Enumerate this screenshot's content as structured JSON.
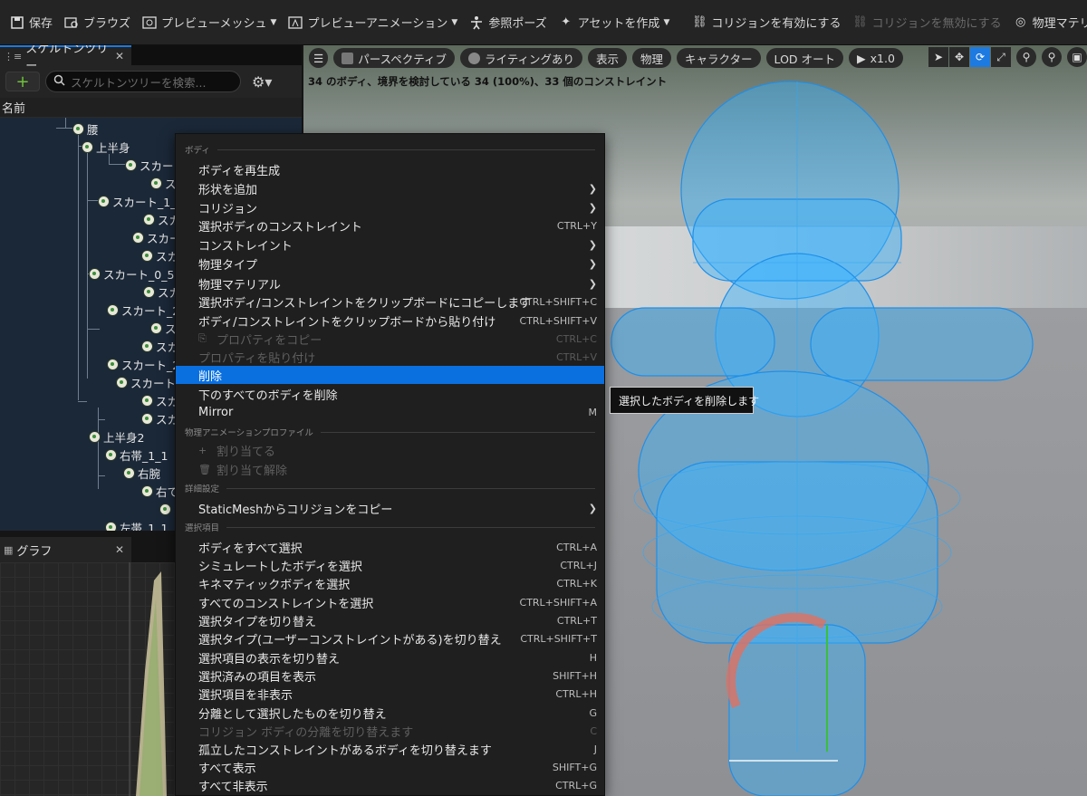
{
  "toolbar": {
    "save": "保存",
    "browse": "ブラウズ",
    "preview_mesh": "プレビューメッシュ",
    "preview_anim": "プレビューアニメーション",
    "ref_pose": "参照ポーズ",
    "create_asset": "アセットを作成",
    "enable_collision": "コリジョンを有効にする",
    "disable_collision": "コリジョンを無効にする",
    "physics_material": "物理マテリア"
  },
  "tree_panel": {
    "tab": "スケルトンツリー",
    "search_placeholder": "スケルトンツリーを検索...",
    "column_name": "名前",
    "rows": [
      "腰",
      "上半身",
      "スカー",
      "ス",
      "スカート_1_",
      "スカ",
      "スカー",
      "スカ",
      "スカート_0_5",
      "スカ",
      "スカート_2",
      "ス",
      "スカ",
      "スカート_2",
      "スカート",
      "スカ",
      "スカ",
      "上半身2",
      "右帯_1_1",
      "右腕",
      "右て",
      "",
      "左帯_1_1",
      "左腕",
      "左て",
      ""
    ]
  },
  "graph_panel": {
    "tab": "グラフ"
  },
  "viewport": {
    "perspective": "パースペクティブ",
    "lighting": "ライティングあり",
    "show": "表示",
    "physics": "物理",
    "character": "キャラクター",
    "lod": "LOD オート",
    "speed": "x1.0",
    "stats": "34 のボディ、境界を検討している 34 (100%)、33 個のコンストレイント"
  },
  "menu": {
    "sections": [
      "ボディ",
      "物理アニメーションプロファイル",
      "詳細設定",
      "選択項目"
    ],
    "items": [
      {
        "label": "ボディを再生成",
        "shortcut": ""
      },
      {
        "label": "形状を追加",
        "shortcut": ""
      },
      {
        "label": "コリジョン",
        "shortcut": ""
      },
      {
        "label": "選択ボディのコンストレイント",
        "shortcut": "CTRL+Y"
      },
      {
        "label": "コンストレイント",
        "shortcut": ""
      },
      {
        "label": "物理タイプ",
        "shortcut": ""
      },
      {
        "label": "物理マテリアル",
        "shortcut": ""
      },
      {
        "label": "選択ボディ/コンストレイントをクリップボードにコピーします",
        "shortcut": "CTRL+SHIFT+C"
      },
      {
        "label": "ボディ/コンストレイントをクリップボードから貼り付け",
        "shortcut": "CTRL+SHIFT+V"
      },
      {
        "label": "プロパティをコピー",
        "shortcut": "CTRL+C"
      },
      {
        "label": "プロパティを貼り付け",
        "shortcut": "CTRL+V"
      },
      {
        "label": "削除",
        "shortcut": ""
      },
      {
        "label": "下のすべてのボディを削除",
        "shortcut": ""
      },
      {
        "label": "Mirror",
        "shortcut": "M"
      },
      {
        "label": "割り当てる",
        "shortcut": ""
      },
      {
        "label": "割り当て解除",
        "shortcut": ""
      },
      {
        "label": "StaticMeshからコリジョンをコピー",
        "shortcut": ""
      },
      {
        "label": "ボディをすべて選択",
        "shortcut": "CTRL+A"
      },
      {
        "label": "シミュレートしたボディを選択",
        "shortcut": "CTRL+J"
      },
      {
        "label": "キネマティックボディを選択",
        "shortcut": "CTRL+K"
      },
      {
        "label": "すべてのコンストレイントを選択",
        "shortcut": "CTRL+SHIFT+A"
      },
      {
        "label": "選択タイプを切り替え",
        "shortcut": "CTRL+T"
      },
      {
        "label": "選択タイプ(ユーザーコンストレイントがある)を切り替え",
        "shortcut": "CTRL+SHIFT+T"
      },
      {
        "label": "選択項目の表示を切り替え",
        "shortcut": "H"
      },
      {
        "label": "選択済みの項目を表示",
        "shortcut": "SHIFT+H"
      },
      {
        "label": "選択項目を非表示",
        "shortcut": "CTRL+H"
      },
      {
        "label": "分離として選択したものを切り替え",
        "shortcut": "G"
      },
      {
        "label": "コリジョン ボディの分離を切り替えます",
        "shortcut": "C"
      },
      {
        "label": "孤立したコンストレイントがあるボディを切り替えます",
        "shortcut": "J"
      },
      {
        "label": "すべて表示",
        "shortcut": "SHIFT+G"
      },
      {
        "label": "すべて非表示",
        "shortcut": "CTRL+G"
      }
    ]
  },
  "tooltip": "選択したボディを削除します",
  "colors": {
    "accent": "#0a70e0",
    "collision_body": "#3ab4ff",
    "tree_bg": "#1b2838"
  }
}
